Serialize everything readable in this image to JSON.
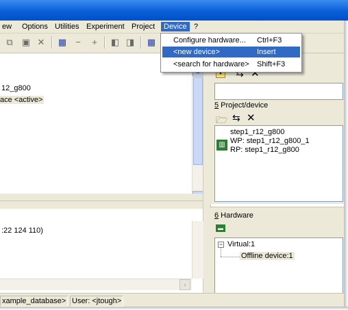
{
  "menu": {
    "items": [
      "ew",
      "Options",
      "Utilities",
      "Experiment",
      "Project",
      "Device",
      "?"
    ],
    "active": "Device"
  },
  "device_menu": {
    "items": [
      {
        "label": "Configure hardware...",
        "shortcut": "Ctrl+F3"
      },
      {
        "label": "<new device>",
        "shortcut": "Insert"
      },
      {
        "label": "<search for hardware>",
        "shortcut": "Shift+F3"
      }
    ]
  },
  "left_panel": {
    "line1": "12_g800",
    "line2": "ace <active>"
  },
  "lower_left": {
    "line1": ":22 124 110)"
  },
  "project_device": {
    "title_num": "5",
    "title_rest": " Project/device",
    "entries": [
      "step1_r12_g800",
      "WP: step1_r12_g800_1",
      "RP: step1_r12_g800"
    ]
  },
  "hardware": {
    "title_num": "6",
    "title_rest": " Hardware",
    "tree": {
      "root": "Virtual:1",
      "child": "Offline device:1",
      "expander": "−"
    }
  },
  "status": {
    "db": "xample_database>",
    "user": "User: <jtough>"
  },
  "colors": {
    "title_bar": "#0a5fd8",
    "menu_highlight": "#316ac5",
    "chrome": "#ece9d8"
  }
}
